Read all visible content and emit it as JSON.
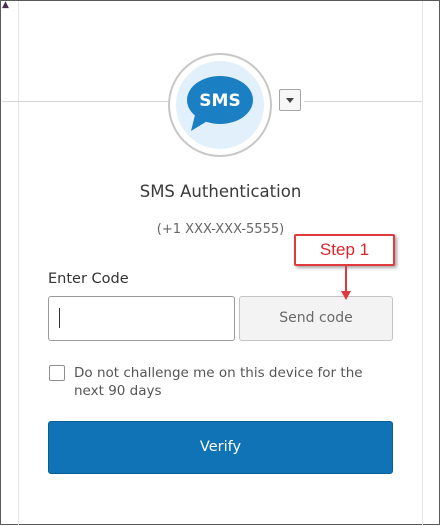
{
  "factor": {
    "icon_text": "SMS",
    "title": "SMS Authentication",
    "phone": "(+1 XXX-XXX-5555)"
  },
  "form": {
    "code_label": "Enter Code",
    "code_value": "",
    "send_code_label": "Send code",
    "remember_device_label": "Do not challenge me on this device for the next 90 days",
    "remember_device_checked": false,
    "verify_label": "Verify"
  },
  "annotation": {
    "callout_text": "Step 1",
    "color": "#e0393e"
  },
  "colors": {
    "primary": "#0f73b5",
    "sms_icon": "#1b7fc4"
  }
}
